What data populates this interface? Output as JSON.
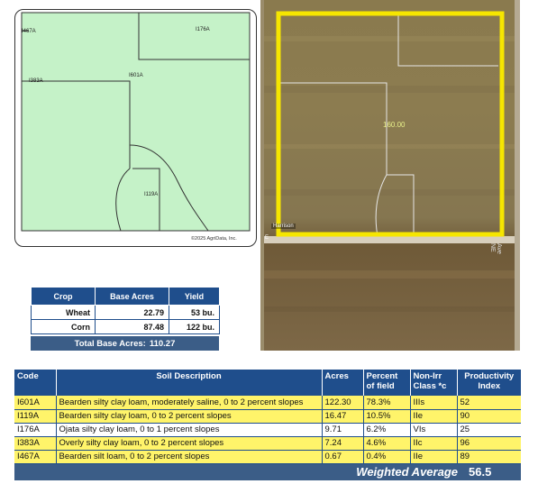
{
  "soil_map": {
    "labels": [
      "I467A",
      "I176A",
      "I383A",
      "I601A",
      "I119A"
    ],
    "copyright": "©2025 AgriData, Inc."
  },
  "aerial": {
    "acres_label": "160.00",
    "road_label_1": "Harrison",
    "road_label_2": "E",
    "road_label_3": "Ave NE",
    "boundary_color": "#f6e600"
  },
  "crop_table": {
    "headers": [
      "Crop",
      "Base Acres",
      "Yield"
    ],
    "rows": [
      [
        "Wheat",
        "22.79",
        "53 bu."
      ],
      [
        "Corn",
        "87.48",
        "122 bu."
      ]
    ],
    "total_label": "Total Base Acres:",
    "total_value": "110.27"
  },
  "soil_table": {
    "headers": {
      "code": "Code",
      "description": "Soil Description",
      "acres": "Acres",
      "percent_line1": "Percent",
      "percent_line2": "of field",
      "class_line1": "Non-Irr",
      "class_line2": "Class *c",
      "pi_line1": "Productivity",
      "pi_line2": "Index"
    },
    "rows": [
      {
        "code": "I601A",
        "description": "Bearden silty clay loam, moderately saline, 0 to 2 percent slopes",
        "acres": "122.30",
        "percent": "78.3%",
        "class": "IIIs",
        "pi": "52"
      },
      {
        "code": "I119A",
        "description": "Bearden silty clay loam, 0 to 2 percent slopes",
        "acres": "16.47",
        "percent": "10.5%",
        "class": "IIe",
        "pi": "90"
      },
      {
        "code": "I176A",
        "description": "Ojata silty clay loam, 0 to 1 percent slopes",
        "acres": "9.71",
        "percent": "6.2%",
        "class": "VIs",
        "pi": "25"
      },
      {
        "code": "I383A",
        "description": "Overly silty clay loam, 0 to 2 percent slopes",
        "acres": "7.24",
        "percent": "4.6%",
        "class": "IIc",
        "pi": "96"
      },
      {
        "code": "I467A",
        "description": "Bearden silt loam, 0 to 2 percent slopes",
        "acres": "0.67",
        "percent": "0.4%",
        "class": "IIe",
        "pi": "89"
      }
    ],
    "weighted_label": "Weighted Average",
    "weighted_value": "56.5"
  },
  "colors": {
    "header_blue": "#1f4e8c",
    "total_bar": "#3b5d87",
    "row_yellow": "#fff46a",
    "map_green": "#c5f2c8"
  }
}
